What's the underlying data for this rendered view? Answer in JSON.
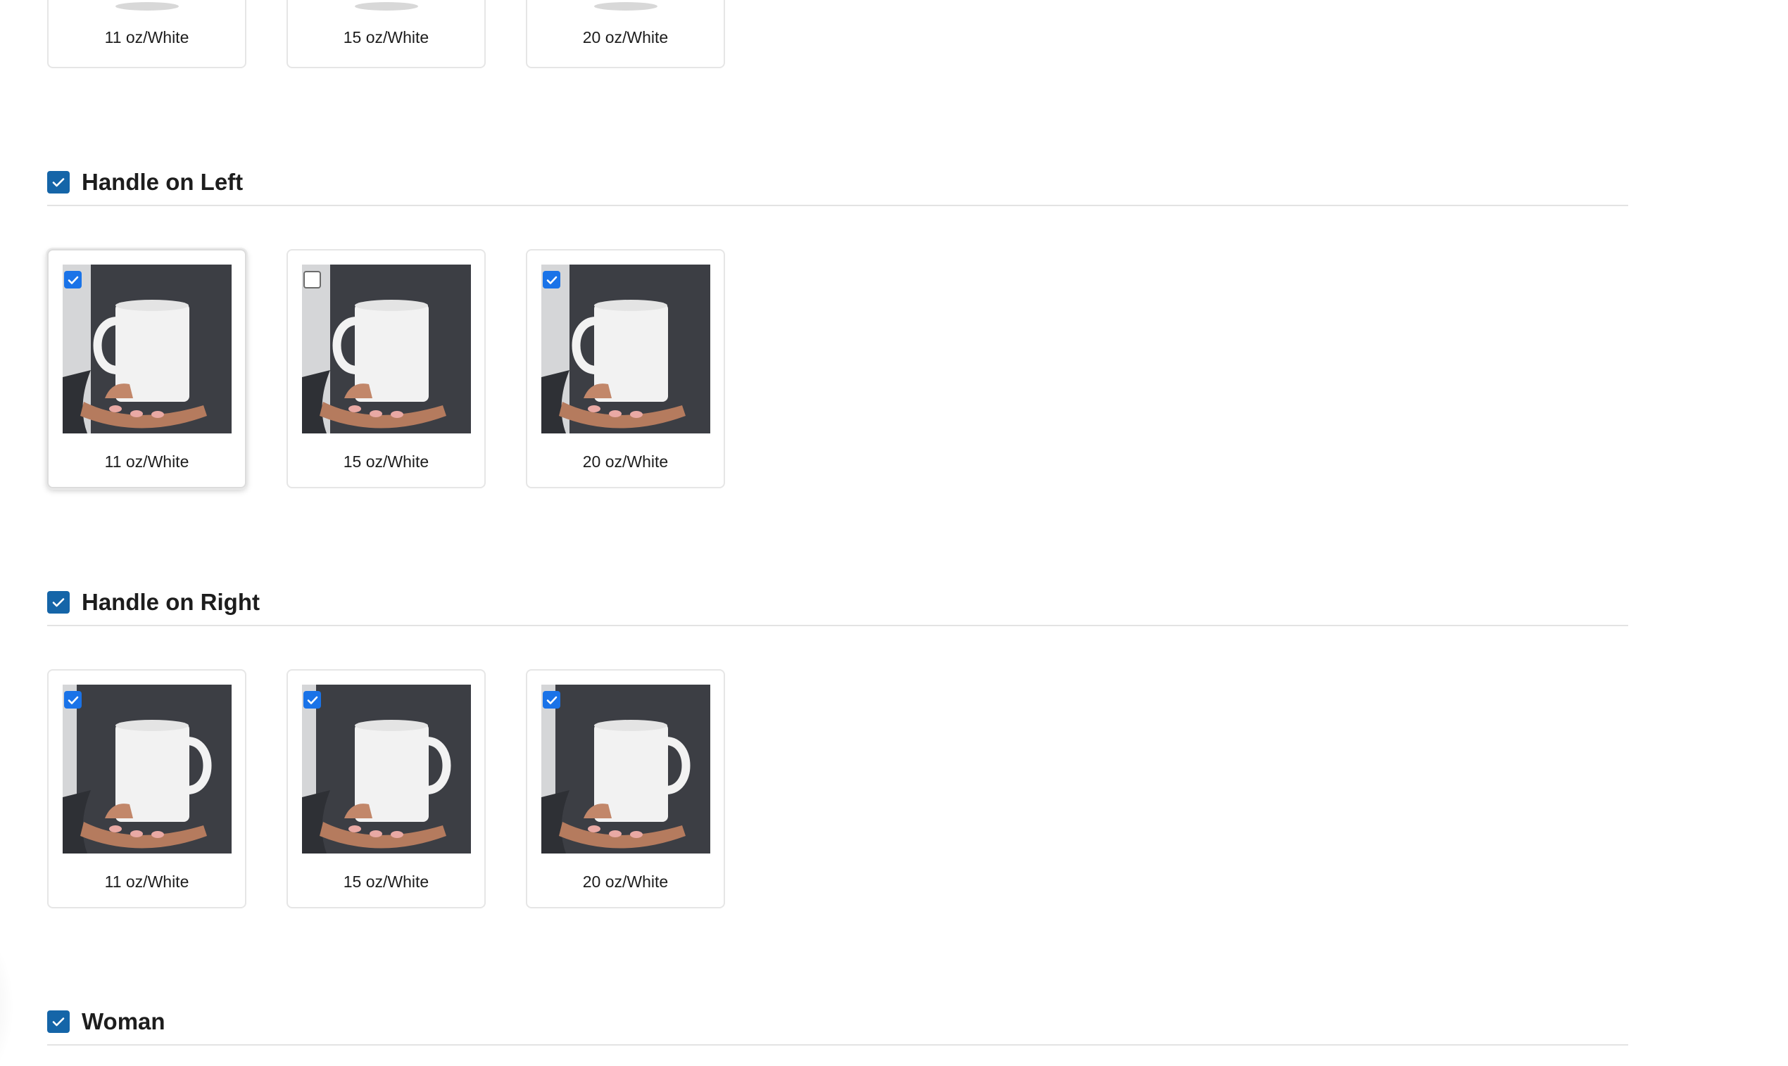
{
  "top_row": {
    "cards": [
      {
        "label": "11 oz/White"
      },
      {
        "label": "15 oz/White"
      },
      {
        "label": "20 oz/White"
      }
    ]
  },
  "sections": [
    {
      "title": "Handle on Left",
      "checked": true,
      "cards": [
        {
          "label": "11 oz/White",
          "checked": true
        },
        {
          "label": "15 oz/White",
          "checked": false
        },
        {
          "label": "20 oz/White",
          "checked": true
        }
      ]
    },
    {
      "title": "Handle on Right",
      "checked": true,
      "cards": [
        {
          "label": "11 oz/White",
          "checked": true
        },
        {
          "label": "15 oz/White",
          "checked": true
        },
        {
          "label": "20 oz/White",
          "checked": true
        }
      ]
    },
    {
      "title": "Woman",
      "checked": true,
      "cards": []
    }
  ],
  "colors": {
    "group_checkbox": "#1565a8",
    "item_checkbox": "#1a73e8",
    "divider": "#e3e3e3"
  }
}
